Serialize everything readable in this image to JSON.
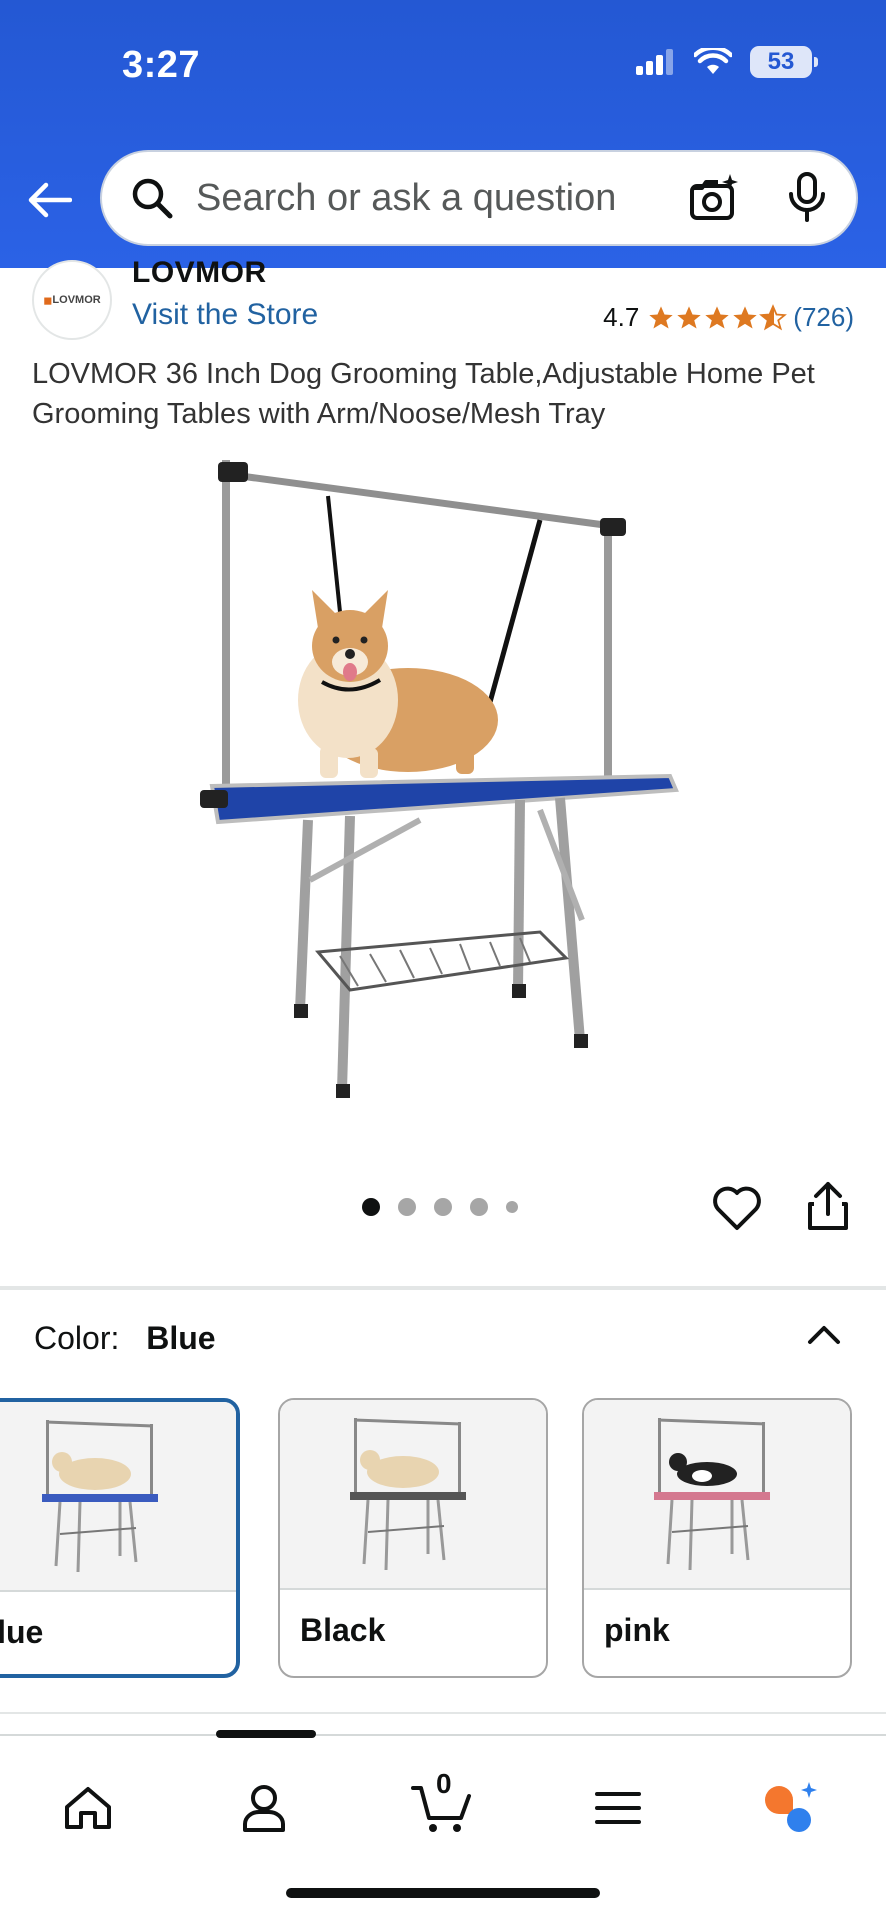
{
  "status_bar": {
    "time": "3:27",
    "battery": "53",
    "icons": [
      "signal-icon",
      "wifi-icon",
      "battery-icon"
    ]
  },
  "header": {
    "back_icon": "back-arrow-icon",
    "search": {
      "placeholder": "Search or ask a question",
      "value": ""
    },
    "icons": [
      "search-icon",
      "camera-icon",
      "microphone-icon"
    ],
    "colors": {
      "background": "#2458d3",
      "accent": "#2b62e6"
    }
  },
  "store": {
    "logo_text": "LOVMOR",
    "brand_name": "LOVMOR",
    "visit_label": "Visit the Store",
    "rating_value": "4.7",
    "rating_stars": 4.7,
    "rating_count": "(726)"
  },
  "product": {
    "title": "LOVMOR 36 Inch Dog Grooming Table,Adjustable Home Pet Grooming Tables with Arm/Noose/Mesh Tray",
    "image_count": 5,
    "active_image": 1
  },
  "actions": {
    "icons": [
      "heart-icon",
      "share-icon"
    ]
  },
  "variation": {
    "label": "Color:",
    "selected": "Blue",
    "options": [
      {
        "name": "Blue",
        "color": "#3a5bbf",
        "selected": true
      },
      {
        "name": "Black",
        "color": "#555555",
        "selected": false
      },
      {
        "name": "pink",
        "color": "#d4788f",
        "selected": false
      }
    ]
  },
  "bottom_nav": {
    "items": [
      "home-icon",
      "account-icon",
      "cart-icon",
      "menu-icon",
      "rufus-icon"
    ],
    "cart_count": "0"
  }
}
